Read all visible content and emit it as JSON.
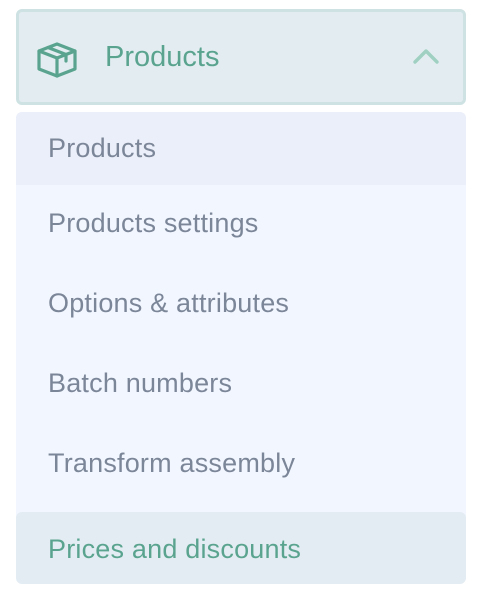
{
  "menu": {
    "header": {
      "icon": "box-icon",
      "title": "Products",
      "toggle_icon": "chevron-up-icon",
      "accent_color": "#5aa48f"
    },
    "items": [
      {
        "label": "Products"
      },
      {
        "label": "Products settings"
      },
      {
        "label": "Options & attributes"
      },
      {
        "label": "Batch numbers"
      },
      {
        "label": "Transform assembly"
      },
      {
        "label": "Prices and discounts",
        "active": true
      }
    ]
  }
}
